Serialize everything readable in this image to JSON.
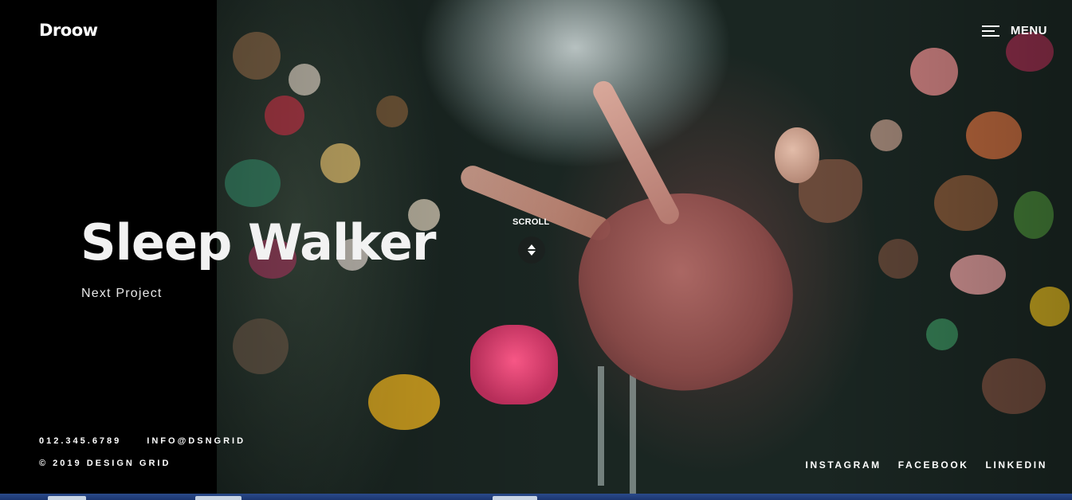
{
  "header": {
    "logo": "Droow",
    "menu_label": "MENU"
  },
  "hero": {
    "title": "Sleep Walker",
    "subtitle": "Next Project",
    "scroll_label": "SCROLL"
  },
  "footer": {
    "phone": "012.345.6789",
    "email": "INFO@DSNGRID",
    "copyright": "© 2019 DESIGN GRID",
    "social": [
      "INSTAGRAM",
      "FACEBOOK",
      "LINKEDIN"
    ]
  },
  "icons": {
    "menu": "hamburger-icon",
    "scroll": "up-down-arrows-icon"
  },
  "colors": {
    "background": "#000000",
    "text": "#ffffff",
    "taskbar": "#1c3670"
  }
}
